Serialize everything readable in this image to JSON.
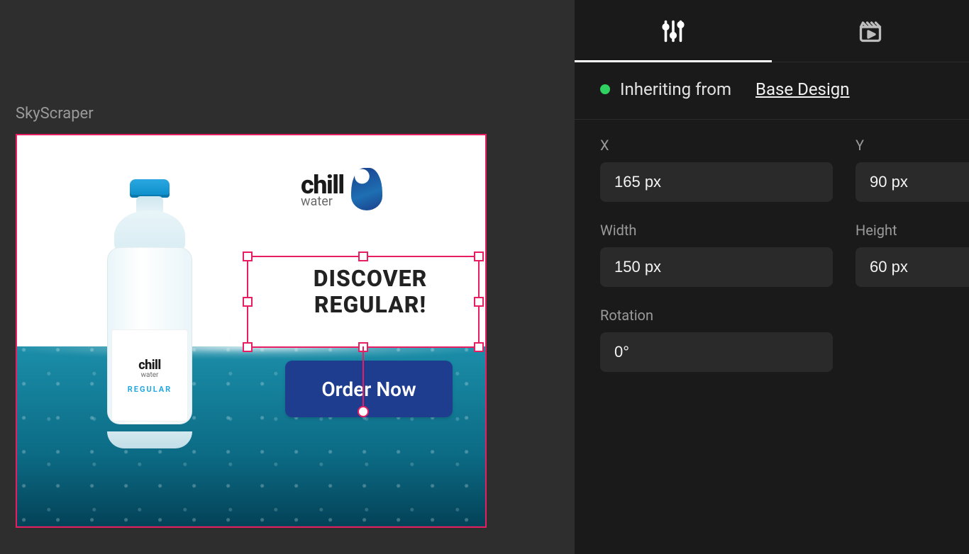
{
  "canvas": {
    "artboardLabel": "SkyScraper",
    "brand": {
      "name": "chill",
      "subbrand": "water"
    },
    "bottleLabelVariant": "REGULAR",
    "headline_line1": "DISCOVER",
    "headline_line2": "REGULAR!",
    "ctaLabel": "Order Now"
  },
  "panel": {
    "inherit": {
      "prefix": "Inheriting from",
      "source": "Base Design"
    },
    "props": {
      "x": {
        "label": "X",
        "value": "165 px"
      },
      "y": {
        "label": "Y",
        "value": "90 px"
      },
      "w": {
        "label": "Width",
        "value": "150 px"
      },
      "h": {
        "label": "Height",
        "value": "60 px"
      },
      "rot": {
        "label": "Rotation",
        "value": "0°"
      }
    }
  }
}
